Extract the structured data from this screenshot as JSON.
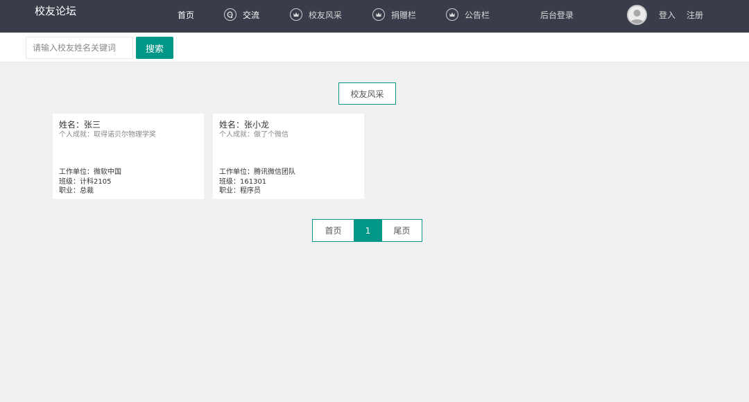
{
  "header": {
    "brand": "校友论坛",
    "nav": [
      {
        "label": "首页",
        "icon": "none"
      },
      {
        "label": "交流",
        "icon": "chat-bubble-icon"
      },
      {
        "label": "校友风采",
        "icon": "crown-icon"
      },
      {
        "label": "捐赠栏",
        "icon": "crown-icon"
      },
      {
        "label": "公告栏",
        "icon": "crown-icon"
      },
      {
        "label": "后台登录",
        "icon": "none"
      }
    ],
    "login": "登入",
    "register": "注册"
  },
  "search": {
    "placeholder": "请输入校友姓名关键词",
    "value": "",
    "button": "搜索"
  },
  "section": {
    "title": "校友风采"
  },
  "cards": [
    {
      "name_label": "姓名：张三",
      "achievement_label": "个人成就：取得诺贝尔物理学奖",
      "work_label": "工作单位：微软中国",
      "class_label": "班级：计科2105",
      "job_label": "职业：总裁"
    },
    {
      "name_label": "姓名：张小龙",
      "achievement_label": "个人成就：做了个微信",
      "work_label": "工作单位：腾讯微信团队",
      "class_label": "班级：161301",
      "job_label": "职业：程序员"
    }
  ],
  "pagination": {
    "first": "首页",
    "current": "1",
    "last": "尾页"
  },
  "colors": {
    "header_bg": "#393d49",
    "accent": "#009688",
    "page_bg": "#f1f1f1"
  }
}
